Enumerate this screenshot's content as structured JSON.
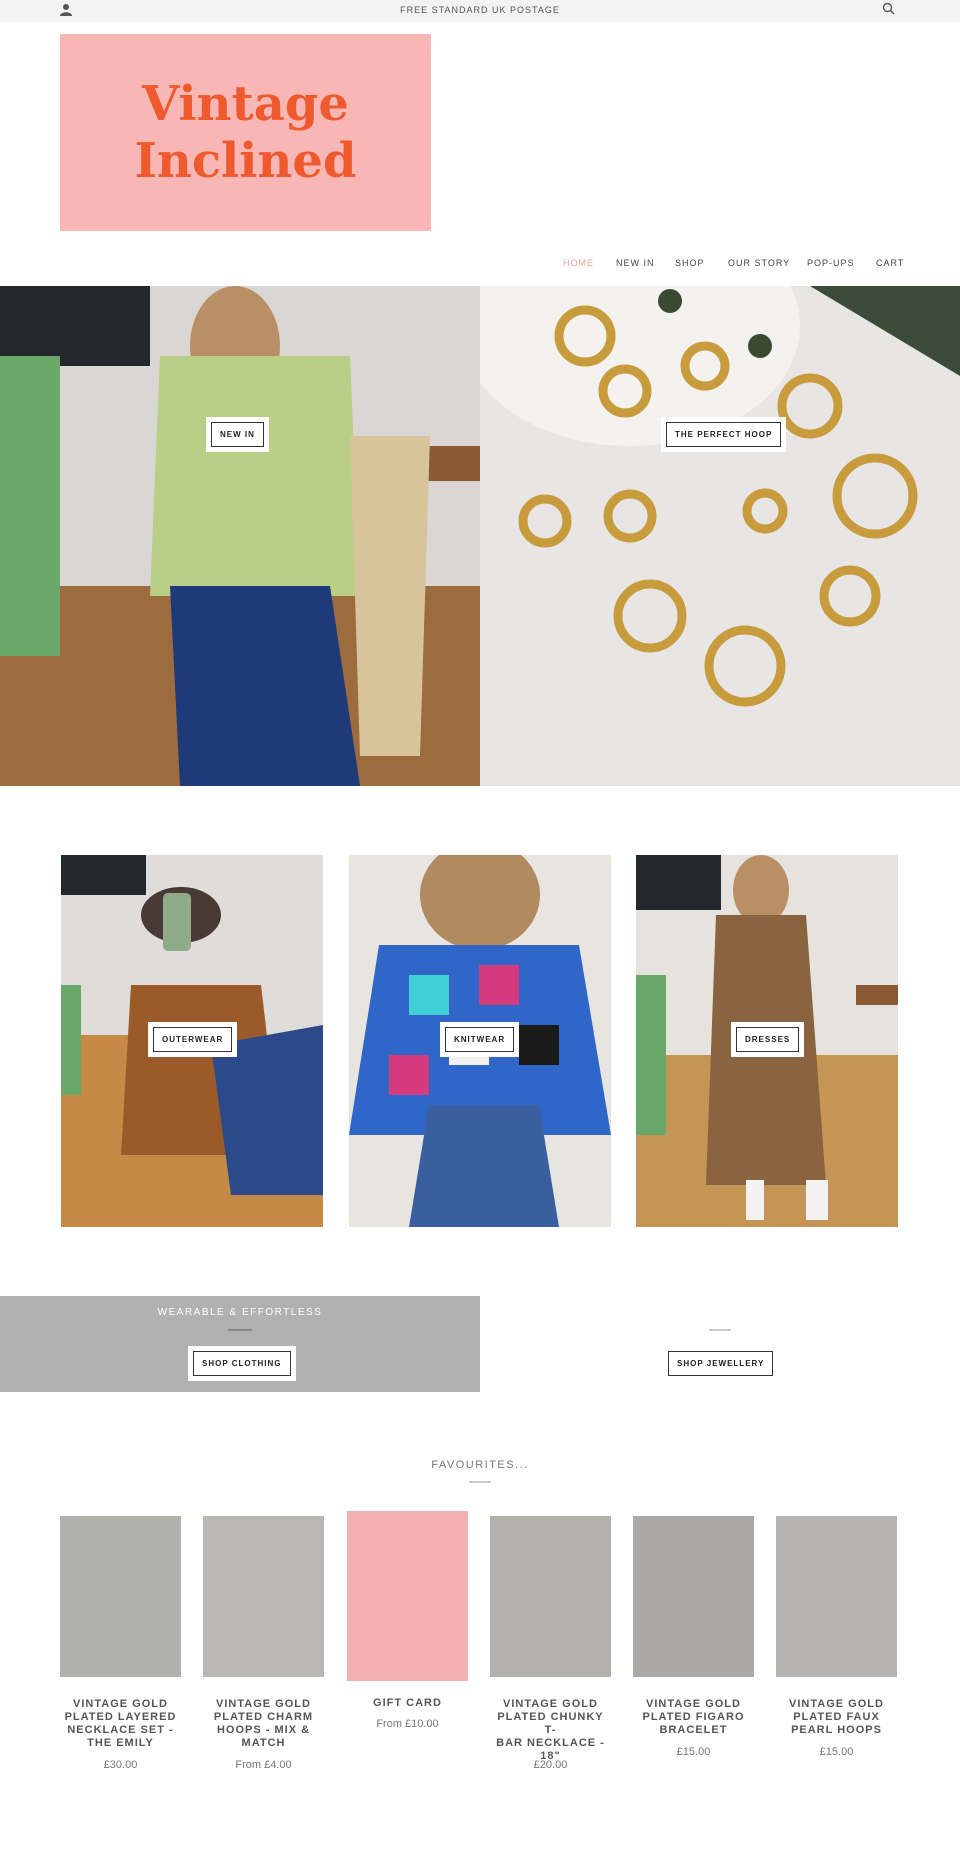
{
  "announcement": "FREE STANDARD UK POSTAGE",
  "header": {
    "icons": {
      "account": "user-icon",
      "search": "search-icon"
    },
    "logo": {
      "line1": "Vintage",
      "line2": "Inclined",
      "bg": "#f8b6b5",
      "color": "#ee5a2e"
    },
    "nav": [
      "HOME",
      "NEW IN",
      "SHOP",
      "OUR STORY",
      "POP-UPS",
      "CART"
    ]
  },
  "hero": [
    {
      "label": "NEW IN"
    },
    {
      "label": "THE PERFECT HOOP"
    }
  ],
  "categories": [
    {
      "label": "OUTERWEAR"
    },
    {
      "label": "KNITWEAR"
    },
    {
      "label": "DRESSES"
    }
  ],
  "banners": {
    "left_heading": "WEARABLE & EFFORTLESS",
    "left_button": "SHOP CLOTHING",
    "right_button": "SHOP JEWELLERY"
  },
  "favourites": {
    "title": "FAVOURITES...",
    "products": [
      {
        "title_lines": [
          "VINTAGE GOLD",
          "PLATED LAYERED",
          "NECKLACE SET -",
          "THE EMILY"
        ],
        "price": "£30.00"
      },
      {
        "title_lines": [
          "VINTAGE GOLD",
          "PLATED CHARM",
          "HOOPS - MIX &",
          "MATCH"
        ],
        "price": "From £4.00"
      },
      {
        "title_lines": [
          "GIFT CARD"
        ],
        "price": "From £10.00"
      },
      {
        "title_lines": [
          "VINTAGE GOLD",
          "PLATED CHUNKY T-",
          "BAR NECKLACE -",
          "18\""
        ],
        "price": "£20.00"
      },
      {
        "title_lines": [
          "VINTAGE GOLD",
          "PLATED FIGARO",
          "BRACELET"
        ],
        "price": "£15.00"
      },
      {
        "title_lines": [
          "VINTAGE GOLD",
          "PLATED FAUX",
          "PEARL HOOPS"
        ],
        "price": "£15.00"
      }
    ]
  }
}
